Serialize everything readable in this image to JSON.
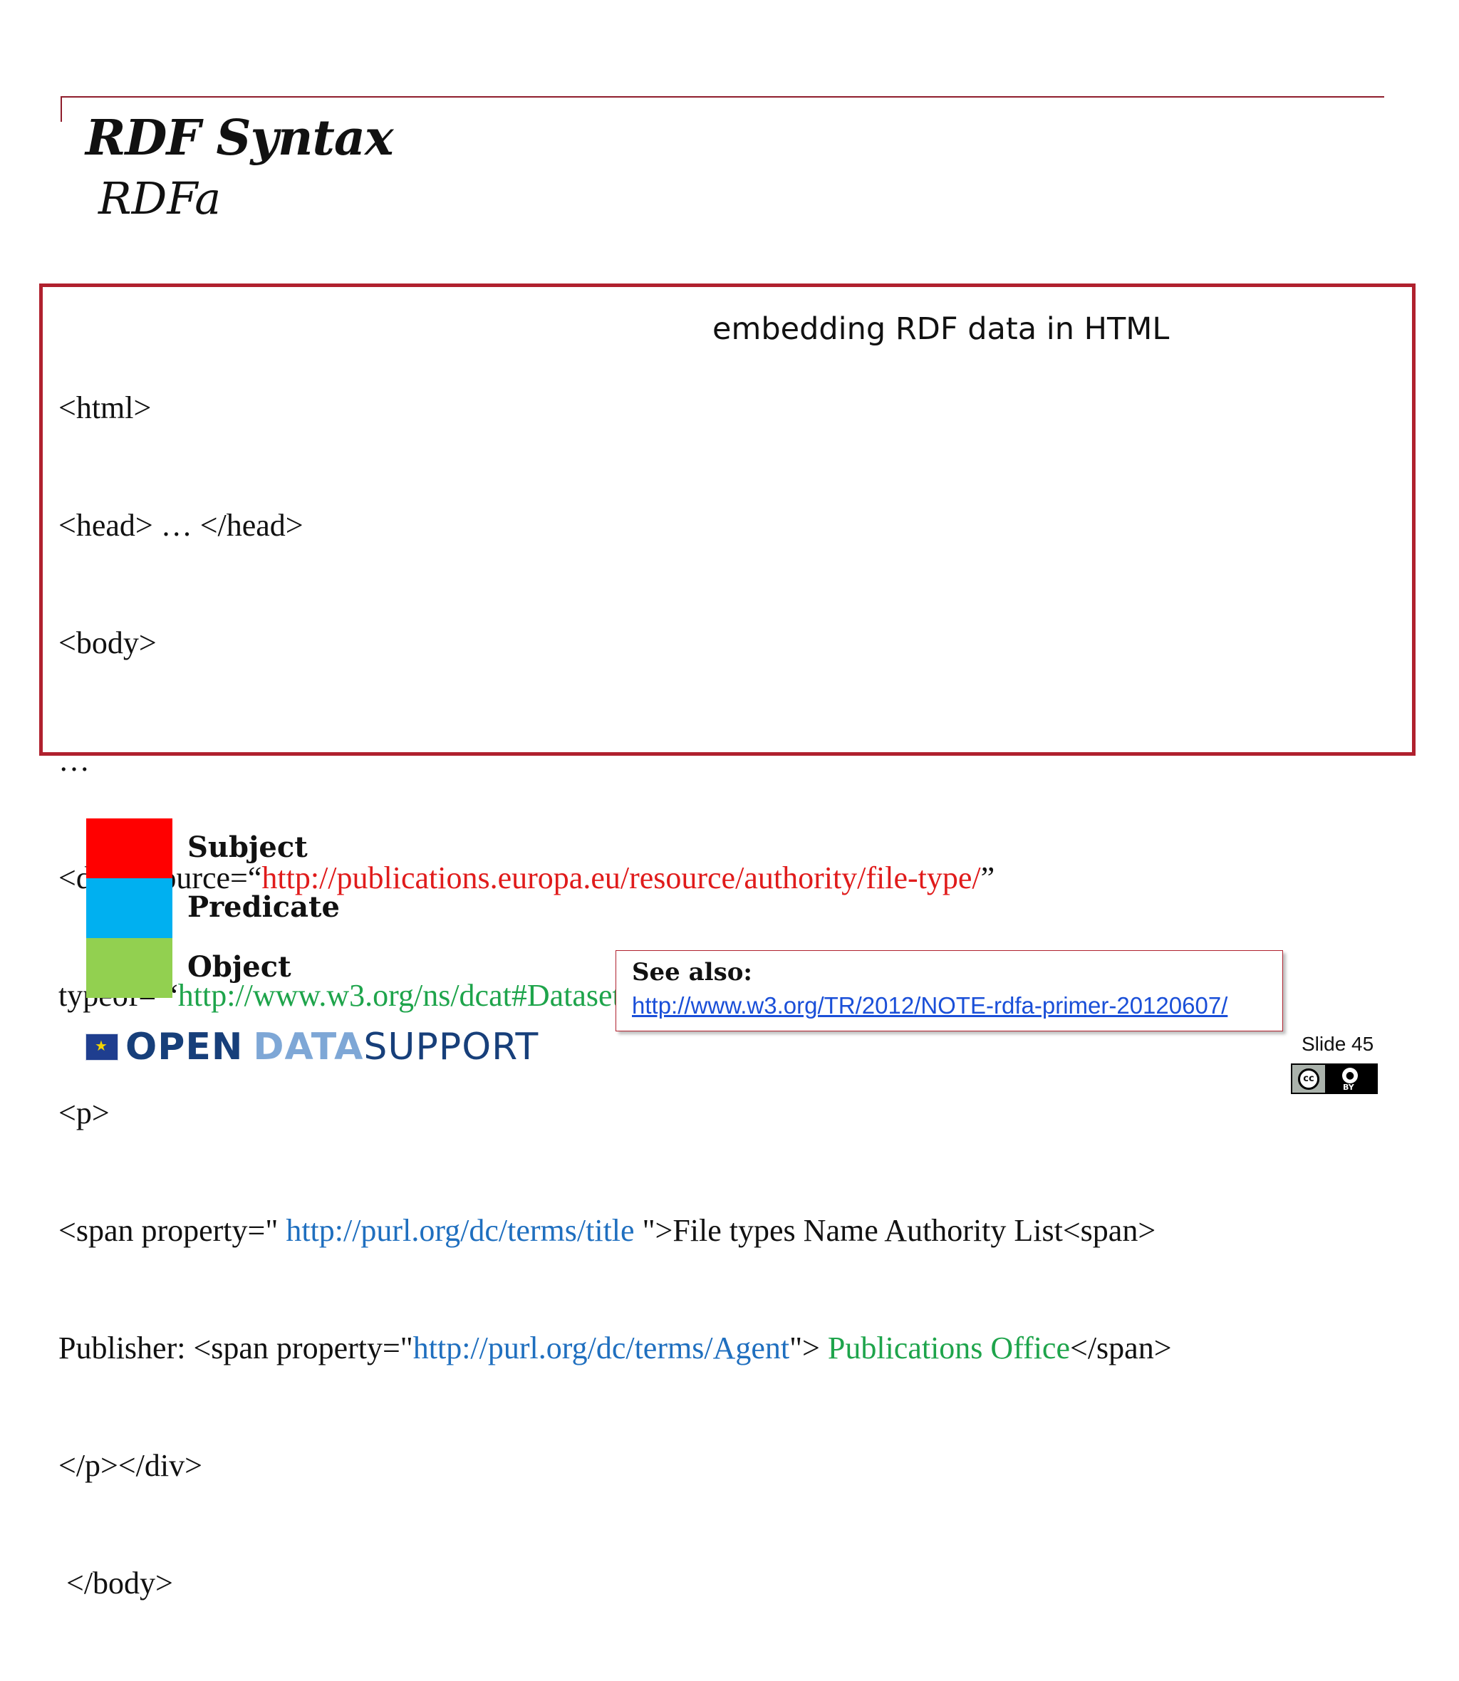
{
  "slide": {
    "title": "RDF Syntax",
    "subtitle": "RDFa",
    "number_label": "Slide 45"
  },
  "code_box": {
    "note": "embedding RDF data in HTML",
    "lines": [
      {
        "parts": [
          "<html>"
        ]
      },
      {
        "parts": [
          "<head> … </head>"
        ]
      },
      {
        "parts": [
          "<body>"
        ]
      },
      {
        "parts": [
          "…"
        ]
      },
      {
        "parts": [
          "<div resource=“",
          "http://publications.europa.eu/resource/authority/file-type/",
          "”"
        ]
      },
      {
        "parts": [
          "typeof= “",
          "http://www.w3.org/ns/dcat#Dataset",
          "”>"
        ]
      },
      {
        "parts": [
          "<p>"
        ]
      },
      {
        "parts": [
          "<span property=\" ",
          "http://purl.org/dc/terms/title",
          " \">File types Name Authority List<span>"
        ]
      },
      {
        "parts": [
          "Publisher: <span property=\"",
          "http://purl.org/dc/terms/Agent",
          "\"> ",
          "Publications Office",
          "</span>"
        ]
      },
      {
        "parts": [
          "</p></div>"
        ]
      },
      {
        "parts": [
          " </body>"
        ]
      }
    ]
  },
  "legend": {
    "items": [
      {
        "label": "Subject",
        "color": "#ff0000"
      },
      {
        "label": "Predicate",
        "color": "#00b0f0"
      },
      {
        "label": "Object",
        "color": "#92d050"
      }
    ]
  },
  "see_also": {
    "title": "See also:",
    "link": "http://www.w3.org/TR/2012/NOTE-rdfa-primer-20120607/"
  },
  "logo": {
    "open": "OPEN",
    "data": "DATA",
    "support": "SUPPORT"
  },
  "license": {
    "cc": "cc",
    "by": "BY"
  },
  "colors": {
    "subject_text": "#e01b1b",
    "predicate_text": "#1f6fbf",
    "object_text": "#1ea44b",
    "accent": "#b0212e"
  }
}
